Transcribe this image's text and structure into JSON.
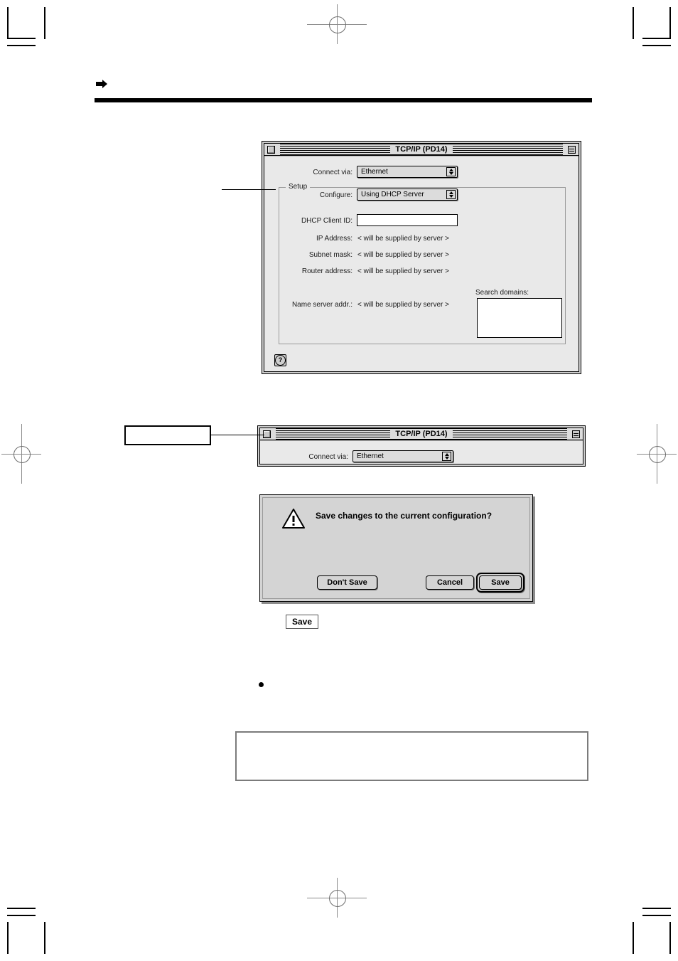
{
  "page": {
    "header": {
      "arrow_icon": "solid-right-arrow",
      "title": ""
    },
    "body_text": "",
    "note_box_text": "",
    "bullet_text": ""
  },
  "window_main": {
    "title": "TCP/IP (PD14)",
    "close_box_icon": "close-box",
    "collapse_box_icon": "collapse-box",
    "connect_via": {
      "label": "Connect via:",
      "value": "Ethernet"
    },
    "setup_group_label": "Setup",
    "configure": {
      "label": "Configure:",
      "value": "Using DHCP Server"
    },
    "dhcp_client_id": {
      "label": "DHCP Client ID:",
      "value": ""
    },
    "ip_address": {
      "label": "IP Address:",
      "value": "< will be supplied by server >"
    },
    "subnet_mask": {
      "label": "Subnet mask:",
      "value": "< will be supplied by server >"
    },
    "router_address": {
      "label": "Router address:",
      "value": "< will be supplied by server >"
    },
    "name_server_addr": {
      "label": "Name server addr.:",
      "value": "< will be supplied by server >"
    },
    "search_domains": {
      "label": "Search domains:",
      "value": ""
    },
    "help_button": {
      "icon": "question-mark-icon",
      "glyph": "?"
    }
  },
  "window_second": {
    "title": "TCP/IP (PD14)",
    "close_box_icon": "close-box",
    "collapse_box_icon": "collapse-box",
    "connect_via": {
      "label": "Connect via:",
      "value": "Ethernet"
    }
  },
  "callout_close": {
    "text": ""
  },
  "alert_dialog": {
    "icon": "caution-triangle-icon",
    "message": "Save changes to the current configuration?",
    "buttons": {
      "dont_save": "Don't Save",
      "cancel": "Cancel",
      "save": "Save"
    }
  },
  "keycap_save": {
    "label": "Save"
  }
}
